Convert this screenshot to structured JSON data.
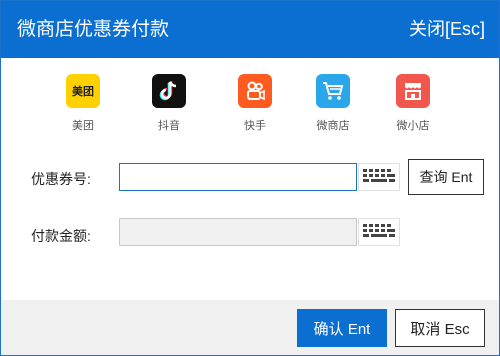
{
  "window": {
    "title": "微商店优惠券付款",
    "close_label": "关闭[Esc]"
  },
  "platforms": [
    {
      "label": "美团",
      "icon": "meituan-icon",
      "color": "#ffd100",
      "glyph": "美团"
    },
    {
      "label": "抖音",
      "icon": "douyin-icon",
      "color": "#111111",
      "glyph": "♪"
    },
    {
      "label": "快手",
      "icon": "kuaishou-icon",
      "color": "#ff5a1f",
      "glyph": ""
    },
    {
      "label": "微商店",
      "icon": "cart-icon",
      "color": "#2aa7ea",
      "glyph": ""
    },
    {
      "label": "微小店",
      "icon": "store-icon",
      "color": "#f2574d",
      "glyph": ""
    }
  ],
  "form": {
    "coupon_label": "优惠券号:",
    "coupon_value": "",
    "amount_label": "付款金额:",
    "amount_value": "",
    "query_label": "查询 Ent"
  },
  "footer": {
    "confirm_label": "确认 Ent",
    "cancel_label": "取消 Esc"
  },
  "colors": {
    "accent": "#0a6fd1",
    "footer_bg": "#f0f0f0"
  }
}
